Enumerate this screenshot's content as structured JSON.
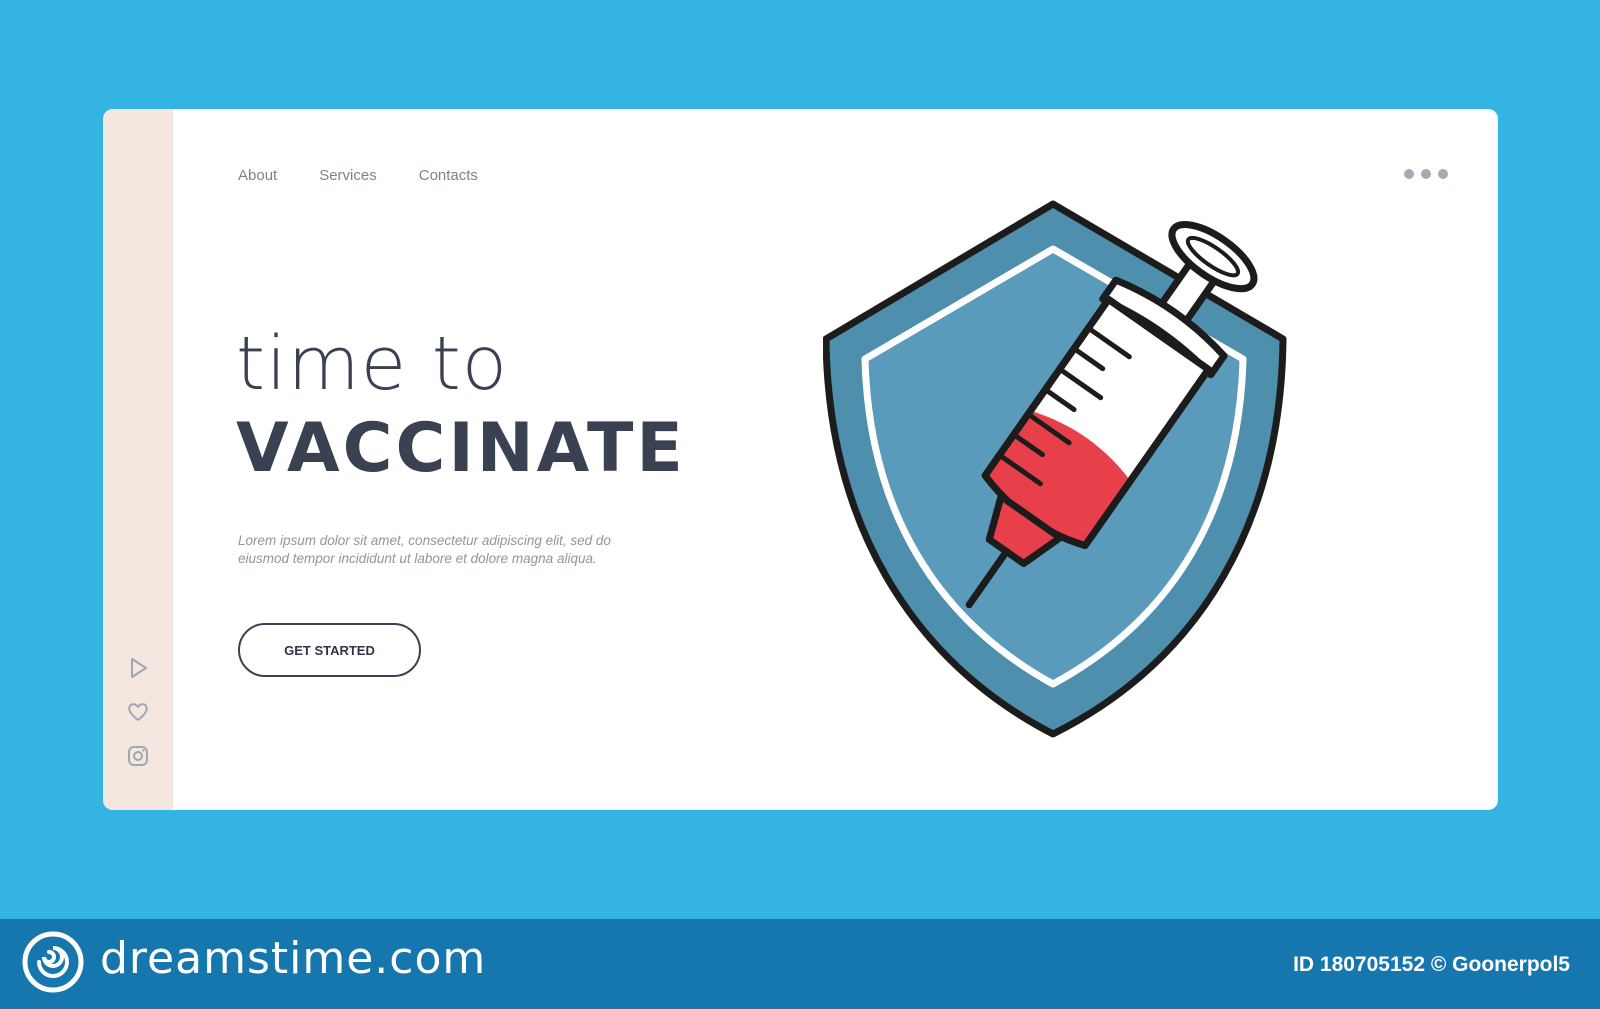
{
  "nav": {
    "items": [
      {
        "label": "About"
      },
      {
        "label": "Services"
      },
      {
        "label": "Contacts"
      }
    ]
  },
  "hero": {
    "line1": "time to",
    "line2": "VACCINATE",
    "description": "Lorem ipsum dolor sit amet, consectetur adipiscing elit, sed do eiusmod tempor incididunt ut labore et dolore magna aliqua.",
    "cta_label": "GET STARTED"
  },
  "sidebar": {
    "icons": [
      "play-icon",
      "heart-icon",
      "instagram-icon"
    ]
  },
  "illustration": {
    "name": "shield-syringe-illustration",
    "colors": {
      "shield_outer": "#4f8fae",
      "shield_inner": "#5a9bbb",
      "liquid": "#e8404a",
      "outline": "#1c1c1c"
    }
  },
  "footer": {
    "brand": "dreamstime.com",
    "credit": "ID 180705152 © Goonerpol5"
  },
  "colors": {
    "background": "#34b4e2",
    "card": "#ffffff",
    "sidebar": "#f3e7df",
    "heading": "#3a4150",
    "footer": "#1577ad"
  }
}
